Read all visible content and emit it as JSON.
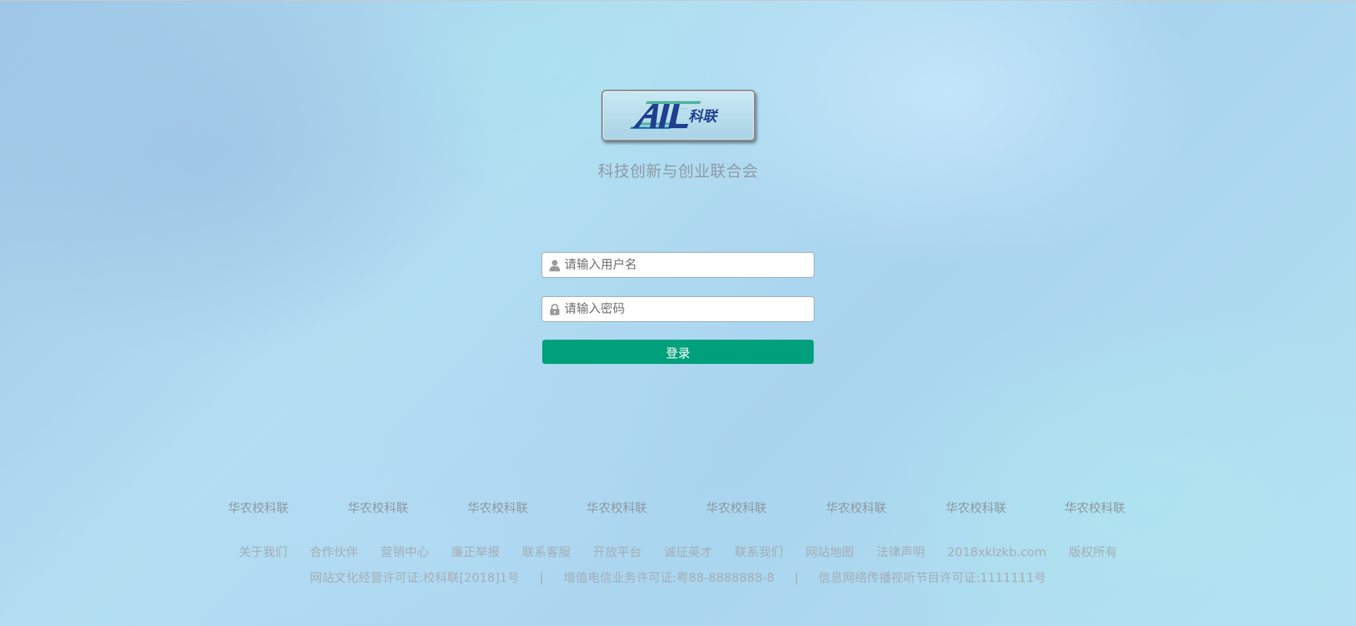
{
  "logo": {
    "text": "科联",
    "letters": "AIL"
  },
  "org_name": "科技创新与创业联合会",
  "login_form": {
    "username_placeholder": "请输入用户名",
    "password_placeholder": "请输入密码",
    "submit_label": "登录",
    "username_icon": "user-icon",
    "password_icon": "lock-icon"
  },
  "partners": [
    "华农校科联",
    "华农校科联",
    "华农校科联",
    "华农校科联",
    "华农校科联",
    "华农校科联",
    "华农校科联",
    "华农校科联"
  ],
  "footer_links": [
    "关于我们",
    "合作伙伴",
    "营销中心",
    "廉正举报",
    "联系客服",
    "开放平台",
    "诚征英才",
    "联系我们",
    "网站地图",
    "法律声明",
    "2018xklzkb.com",
    "版权所有"
  ],
  "licenses": {
    "items": [
      "网站文化经营许可证:校科联[2018]1号",
      "增值电信业务许可证:粤88-8888888-8",
      "信息网络传播视听节目许可证:1111111号"
    ],
    "separator": "|"
  },
  "colors": {
    "button_green": "#00a07c",
    "logo_blue": "#1f3f8f",
    "logo_teal": "#3fae96"
  }
}
